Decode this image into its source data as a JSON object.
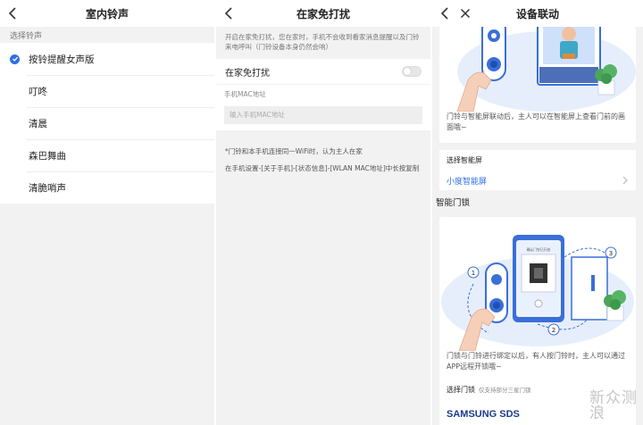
{
  "panel1": {
    "title": "室内铃声",
    "section_label": "选择铃声",
    "options": [
      {
        "label": "按铃提醒女声版",
        "selected": true
      },
      {
        "label": "叮咚",
        "selected": false
      },
      {
        "label": "清晨",
        "selected": false
      },
      {
        "label": "森巴舞曲",
        "selected": false
      },
      {
        "label": "清脆哨声",
        "selected": false
      }
    ]
  },
  "panel2": {
    "title": "在家免打扰",
    "description": "开启在家免打扰，您在家时，手机不会收到看家消息提醒以及门铃来电呼叫（门铃设备本身仍然会响）",
    "toggle_label": "在家免打扰",
    "toggle_on": false,
    "mac_label": "手机MAC地址",
    "mac_placeholder": "输入手机MAC地址",
    "hint1": "*门铃和本手机连接同一WiFi时，认为主人在家",
    "hint2": "在手机设置-[关于手机]-[状态信息]-[WLAN MAC地址]中长按复制"
  },
  "panel3": {
    "title": "设备联动",
    "card1_text": "门铃与智能屏联动后，主人可以在智能屏上查看门前的画面哦~",
    "select_screen_label": "选择智能屏",
    "screen_value": "小度智能屏",
    "section_lock": "智能门锁",
    "card2_text": "门锁与门铃进行绑定以后，有人按门铃时，主人可以通过APP远程开锁哦~",
    "select_lock_label": "选择门锁",
    "select_lock_sub": "仅支持部分三星门锁",
    "lock_brand": "SAMSUNG SDS",
    "step_numbers": [
      "1",
      "2",
      "3"
    ],
    "phone_text": "确认门铃已开启"
  },
  "watermark": {
    "line1": "新",
    "line2": "浪",
    "line3": "众测"
  },
  "colors": {
    "accent": "#2f6fe4",
    "illustration_blue": "#3a6fd8",
    "illustration_light": "#dde8fb",
    "brand": "#1b3a8a"
  }
}
